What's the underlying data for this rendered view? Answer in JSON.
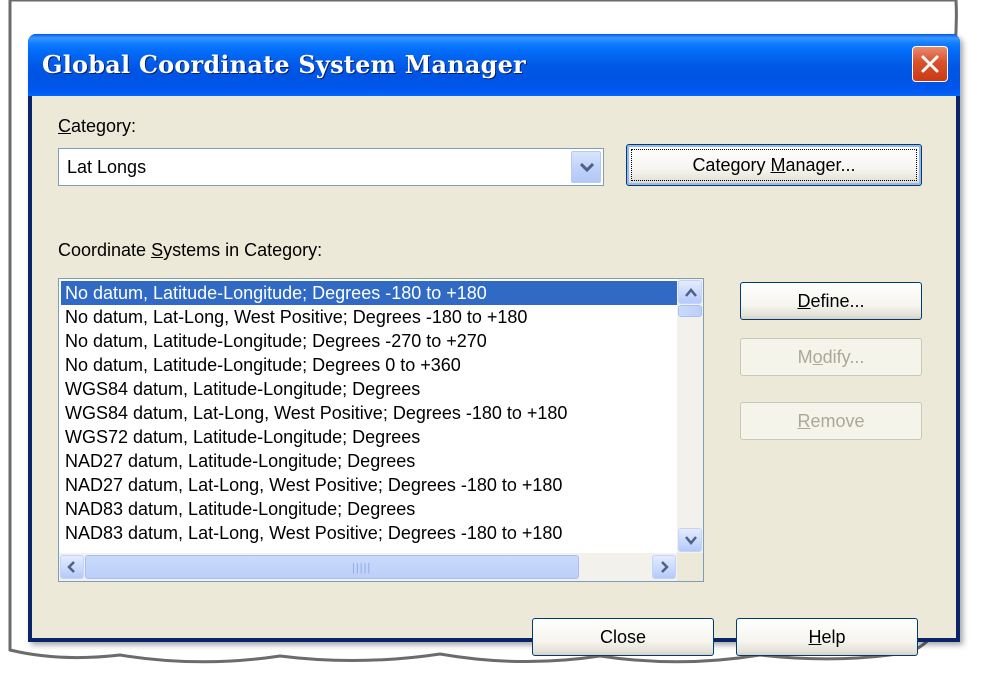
{
  "window": {
    "title": "Global Coordinate System Manager"
  },
  "category": {
    "label_prefix": "",
    "label_accel": "C",
    "label_rest": "ategory:",
    "selected": "Lat Longs"
  },
  "buttons": {
    "category_manager": {
      "prefix": "Category ",
      "accel": "M",
      "rest": "anager..."
    },
    "define": {
      "prefix": "",
      "accel": "D",
      "rest": "efine..."
    },
    "modify": {
      "prefix": "M",
      "accel": "o",
      "rest": "dify..."
    },
    "remove": {
      "prefix": "",
      "accel": "R",
      "rest": "emove"
    },
    "close": "Close",
    "help": {
      "prefix": "",
      "accel": "H",
      "rest": "elp"
    }
  },
  "systems": {
    "label_prefix": "Coordinate ",
    "label_accel": "S",
    "label_rest": "ystems in Category:",
    "items": [
      "No datum, Latitude-Longitude; Degrees -180 to +180",
      "No datum, Lat-Long, West Positive; Degrees -180 to +180",
      "No datum, Latitude-Longitude; Degrees -270 to +270",
      "No datum, Latitude-Longitude; Degrees 0 to +360",
      "WGS84 datum, Latitude-Longitude; Degrees",
      "WGS84 datum, Lat-Long, West Positive; Degrees -180 to +180",
      "WGS72 datum, Latitude-Longitude; Degrees",
      "NAD27 datum, Latitude-Longitude; Degrees",
      "NAD27 datum, Lat-Long, West Positive; Degrees -180 to +180",
      "NAD83 datum, Latitude-Longitude; Degrees",
      "NAD83 datum, Lat-Long, West Positive; Degrees -180 to +180"
    ],
    "selected_index": 0
  }
}
